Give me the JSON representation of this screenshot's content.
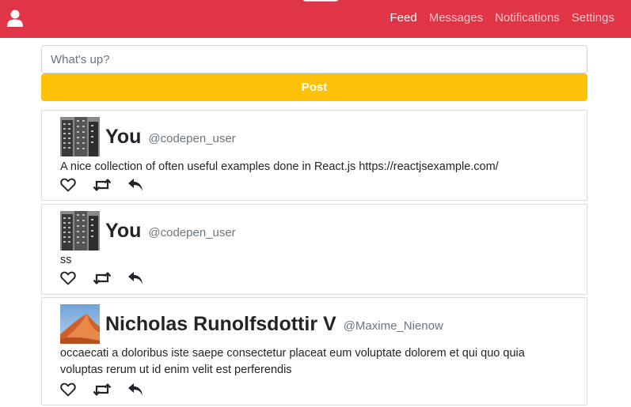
{
  "nav": {
    "user_icon": "user-icon",
    "links": [
      {
        "label": "Feed",
        "active": true
      },
      {
        "label": "Messages",
        "active": false
      },
      {
        "label": "Notifications",
        "active": false
      },
      {
        "label": "Settings",
        "active": false
      }
    ]
  },
  "compose": {
    "placeholder": "What's up?",
    "post_label": "Post"
  },
  "tweets": [
    {
      "name": "You",
      "handle": "@codepen_user",
      "text": "A nice collection of often useful examples done in React.js https://reactjsexample.com/",
      "avatar": "building-photo"
    },
    {
      "name": "You",
      "handle": "@codepen_user",
      "text": "ss",
      "avatar": "building-photo"
    },
    {
      "name": "Nicholas Runolfsdottir V",
      "handle": "@Maxime_Nienow",
      "text": "occaecati a doloribus iste saepe consectetur placeat eum voluptate dolorem et qui quo quia voluptas rerum ut id enim velit est perferendis",
      "avatar": "desert-dune-photo"
    }
  ],
  "colors": {
    "navbar": "#e03546",
    "post_button": "#ffc107",
    "border": "#dcdcdc"
  }
}
